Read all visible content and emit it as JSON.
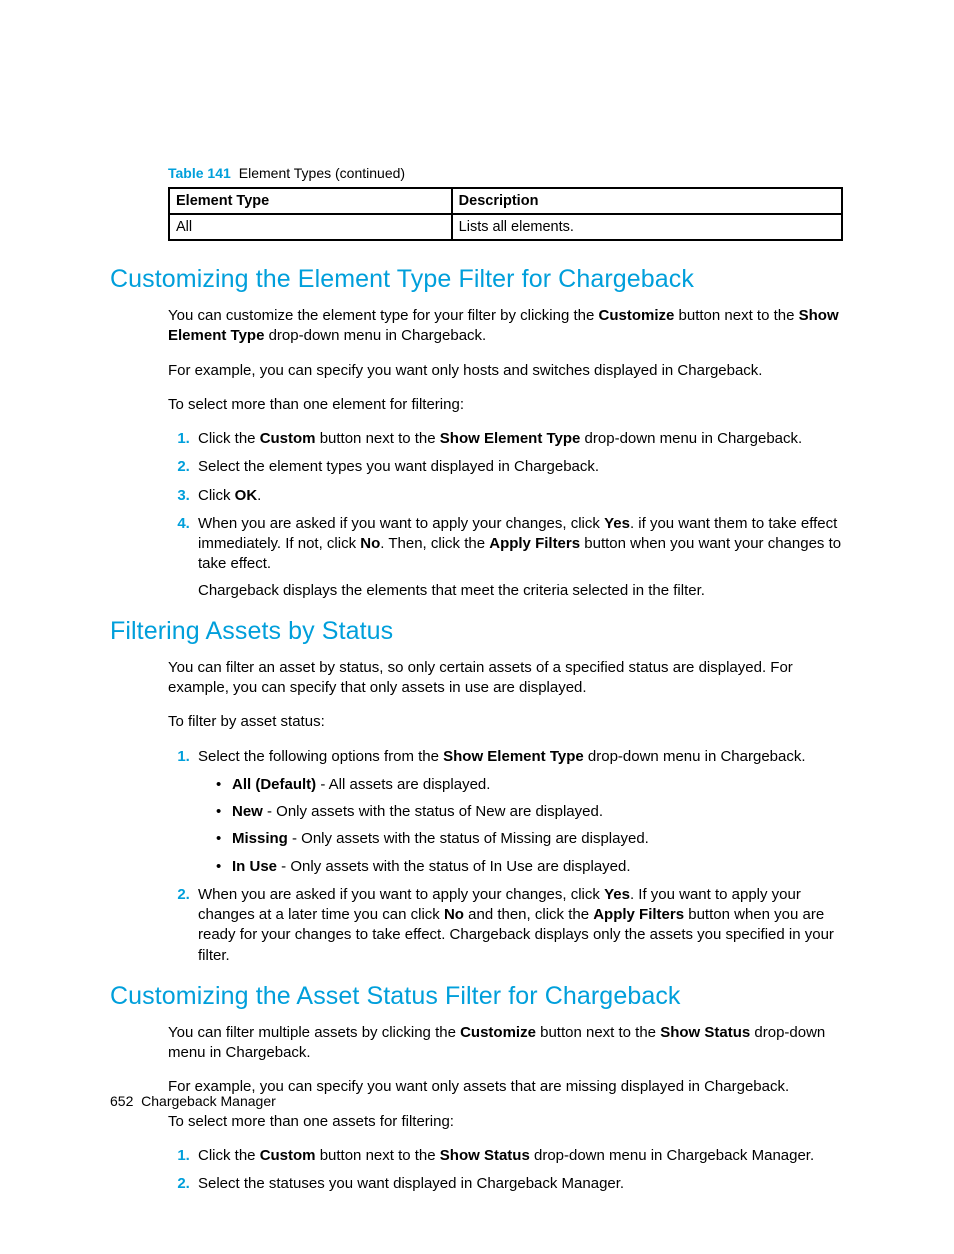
{
  "table": {
    "caption_label": "Table 141",
    "caption_title": "Element Types (continued)",
    "header_col1": "Element Type",
    "header_col2": "Description",
    "row1_col1": "All",
    "row1_col2": "Lists all elements."
  },
  "sect1": {
    "heading": "Customizing the Element Type Filter for Chargeback",
    "p1a": "You can customize the element type for your filter by clicking the ",
    "p1b": "Customize",
    "p1c": " button next to the ",
    "p1d": "Show Element Type",
    "p1e": " drop-down menu in Chargeback.",
    "p2": "For example, you can specify you want only hosts and switches displayed in Chargeback.",
    "p3": "To select more than one element for filtering:",
    "s1a": "Click the ",
    "s1b": "Custom",
    "s1c": " button next to the ",
    "s1d": "Show Element Type",
    "s1e": " drop-down menu in Chargeback.",
    "s2": "Select the element types you want displayed in Chargeback.",
    "s3a": "Click ",
    "s3b": "OK",
    "s3c": ".",
    "s4a": "When you are asked if you want to apply your changes, click ",
    "s4b": "Yes",
    "s4c": ". if you want them to take effect immediately. If not, click ",
    "s4d": "No",
    "s4e": ". Then, click the ",
    "s4f": "Apply Filters",
    "s4g": " button when you want your changes to take effect.",
    "s4p2": "Chargeback displays the elements that meet the criteria selected in the filter."
  },
  "sect2": {
    "heading": "Filtering Assets by Status",
    "p1": "You can filter an asset by status, so only certain assets of a specified status are displayed. For example, you can specify that only assets in use are displayed.",
    "p2": "To filter by asset status:",
    "s1a": "Select the following options from the ",
    "s1b": "Show Element Type",
    "s1c": " drop-down menu in Chargeback.",
    "b1a": "All (Default)",
    "b1b": " - All assets are displayed.",
    "b2a": "New",
    "b2b": " - Only assets with the status of New are displayed.",
    "b3a": "Missing",
    "b3b": " - Only assets with the status of Missing are displayed.",
    "b4a": "In Use",
    "b4b": " - Only assets with the status of In Use are displayed.",
    "s2a": "When you are asked if you want to apply your changes, click ",
    "s2b": "Yes",
    "s2c": ". If you want to apply your changes at a later time you can click ",
    "s2d": "No",
    "s2e": " and then, click the ",
    "s2f": "Apply Filters",
    "s2g": " button when you are ready for your changes to take effect. Chargeback displays only the assets you specified in your filter."
  },
  "sect3": {
    "heading": "Customizing the Asset Status Filter for Chargeback",
    "p1a": "You can filter multiple assets by clicking the ",
    "p1b": "Customize",
    "p1c": " button next to the ",
    "p1d": "Show Status",
    "p1e": " drop-down menu in Chargeback.",
    "p2": "For example, you can specify you want only assets that are missing displayed in Chargeback.",
    "p3": "To select more than one assets for filtering:",
    "s1a": "Click the ",
    "s1b": "Custom",
    "s1c": " button next to the ",
    "s1d": "Show Status",
    "s1e": " drop-down menu in Chargeback Manager.",
    "s2": "Select the statuses you want displayed in Chargeback Manager."
  },
  "footer": {
    "page_num": "652",
    "chapter": "Chargeback Manager"
  }
}
